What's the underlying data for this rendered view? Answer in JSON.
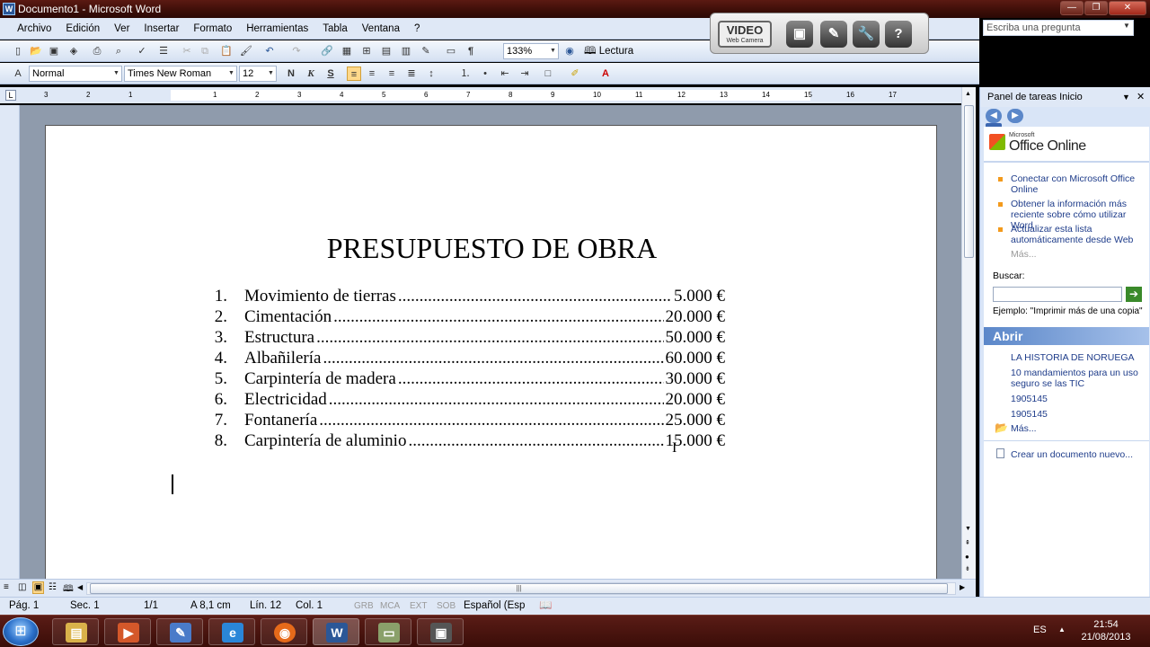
{
  "window": {
    "title": "Documento1 - Microsoft Word",
    "app_icon": "W"
  },
  "menu": [
    "Archivo",
    "Edición",
    "Ver",
    "Insertar",
    "Formato",
    "Herramientas",
    "Tabla",
    "Ventana",
    "?"
  ],
  "toolbar": {
    "zoom": "133%",
    "read_label": "Lectura",
    "style": "Normal",
    "font": "Times New Roman",
    "size": "12",
    "bold": "N",
    "italic": "K",
    "underline": "S"
  },
  "video_bar": {
    "logo": "VIDEO",
    "sub": "Web Camera",
    "help": "?"
  },
  "help_box": {
    "placeholder": "Escriba una pregunta"
  },
  "ruler": {
    "ticks": [
      "3",
      "2",
      "1",
      "1",
      "2",
      "3",
      "4",
      "5",
      "6",
      "7",
      "8",
      "9",
      "10",
      "11",
      "12",
      "13",
      "14",
      "15",
      "16",
      "17"
    ]
  },
  "document": {
    "title": "PRESUPUESTO DE OBRA",
    "items": [
      {
        "num": "1.",
        "label": "Movimiento de tierras ",
        "value": "5.000 €"
      },
      {
        "num": "2.",
        "label": "Cimentación ",
        "value": "20.000 €"
      },
      {
        "num": "3.",
        "label": "Estructura ",
        "value": "50.000 €"
      },
      {
        "num": "4.",
        "label": "Albañilería",
        "value": "60.000 €"
      },
      {
        "num": "5.",
        "label": "Carpintería de madera ",
        "value": "30.000 €"
      },
      {
        "num": "6.",
        "label": "Electricidad ",
        "value": "20.000 €"
      },
      {
        "num": "7.",
        "label": "Fontanería",
        "value": "25.000 €"
      },
      {
        "num": "8.",
        "label": "Carpintería de aluminio ",
        "value": "15.000 €"
      }
    ]
  },
  "status": {
    "page": "Pág. 1",
    "section": "Sec. 1",
    "pages": "1/1",
    "at": "A 8,1 cm",
    "line": "Lín. 12",
    "col": "Col. 1",
    "grb": "GRB",
    "mca": "MCA",
    "ext": "EXT",
    "sob": "SOB",
    "language": "Español (Esp"
  },
  "task_pane": {
    "title": "Panel de tareas Inicio",
    "office_online": "Office Online",
    "office_microsoft": "Microsoft",
    "links": [
      "Conectar con Microsoft Office Online",
      "Obtener la información más reciente sobre cómo utilizar Word",
      "Actualizar esta lista automáticamente desde Web"
    ],
    "more": "Más...",
    "search_label": "Buscar:",
    "example": "Ejemplo: \"Imprimir más de una copia\"",
    "open_title": "Abrir",
    "recent": [
      "LA HISTORIA DE NORUEGA",
      "10 mandamientos para un uso seguro se las TIC",
      "1905145",
      "1905145"
    ],
    "open_more": "Más...",
    "new_doc": "Crear un documento nuevo..."
  },
  "taskbar": {
    "lang": "ES",
    "time": "21:54",
    "date": "21/08/2013",
    "word_icon": "W"
  }
}
